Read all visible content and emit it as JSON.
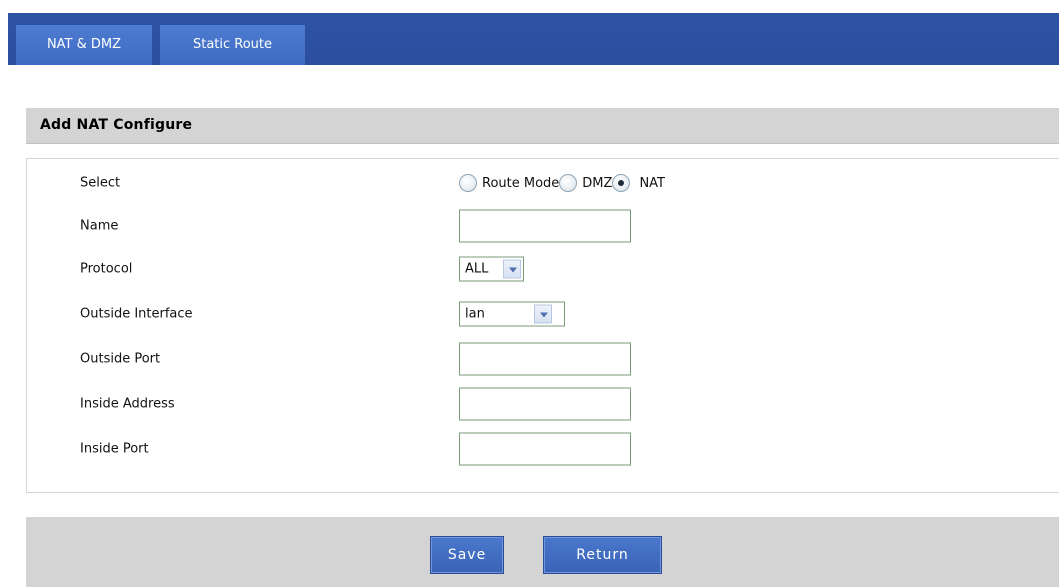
{
  "tabs": [
    {
      "label": "NAT & DMZ"
    },
    {
      "label": "Static Route"
    }
  ],
  "section": {
    "title": "Add NAT Configure"
  },
  "form": {
    "select": {
      "label": "Select",
      "options": [
        {
          "label": "Route Mode",
          "checked": false
        },
        {
          "label": "DMZ",
          "checked": false
        },
        {
          "label": "NAT",
          "checked": true
        }
      ]
    },
    "name": {
      "label": "Name",
      "value": ""
    },
    "protocol": {
      "label": "Protocol",
      "value": "ALL"
    },
    "outside_interface": {
      "label": "Outside Interface",
      "value": "lan"
    },
    "outside_port": {
      "label": "Outside Port",
      "value": ""
    },
    "inside_address": {
      "label": "Inside Address",
      "value": ""
    },
    "inside_port": {
      "label": "Inside Port",
      "value": ""
    }
  },
  "actions": {
    "save_label": "Save",
    "return_label": "Return"
  },
  "colors": {
    "header_blue": "#2f54a6",
    "tab_blue": "#4d7bd0",
    "button_blue": "#3a63b6",
    "panel_gray": "#d4d4d4"
  }
}
